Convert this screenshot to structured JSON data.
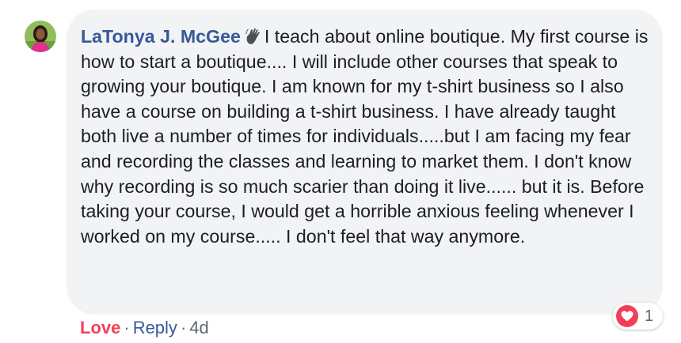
{
  "comment": {
    "author": "LaTonya J. McGee",
    "badge_icon": "waving-hand-icon",
    "text": "I teach about online boutique. My first course is how to start a boutique.... I will include other courses that speak to growing your boutique. I am known for my t-shirt business so I also have a course on building a t-shirt business. I have already taught both live a number of times for individuals.....but I am facing my fear and recording the classes and learning to market them. I don't know why recording is so much scarier than doing it live...... but it is. Before taking your course, I would get a horrible anxious feeling whenever I worked on my course..... I don't feel that way anymore."
  },
  "reactions": {
    "icon": "heart-icon",
    "count": "1"
  },
  "actions": {
    "love_label": "Love",
    "separator": "·",
    "reply_label": "Reply",
    "timestamp": "4d"
  },
  "colors": {
    "author_blue": "#385898",
    "love_red": "#f33e58",
    "bubble_bg": "#f2f3f5",
    "meta_gray": "#606770"
  }
}
